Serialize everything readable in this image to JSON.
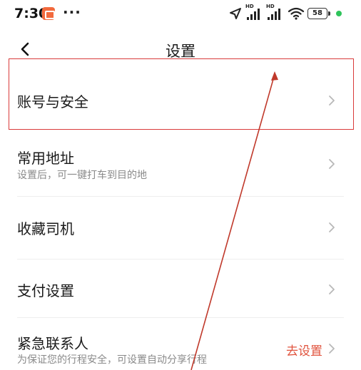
{
  "status_bar": {
    "time": "7:30",
    "battery": "58",
    "hd": "HD",
    "accent_green": "#2fc45b",
    "notification_icon": "app-notification-icon"
  },
  "header": {
    "title": "设置",
    "back_icon": "chevron-left-icon"
  },
  "settings": [
    {
      "label": "账号与安全",
      "sub": "",
      "action": ""
    },
    {
      "label": "常用地址",
      "sub": "设置后，可一键打车到目的地",
      "action": ""
    },
    {
      "label": "收藏司机",
      "sub": "",
      "action": ""
    },
    {
      "label": "支付设置",
      "sub": "",
      "action": ""
    },
    {
      "label": "紧急联系人",
      "sub": "为保证您的行程安全，可设置自动分享行程",
      "action": "去设置"
    }
  ],
  "colors": {
    "highlight": "#d93b3b",
    "action_text": "#e0533d"
  }
}
